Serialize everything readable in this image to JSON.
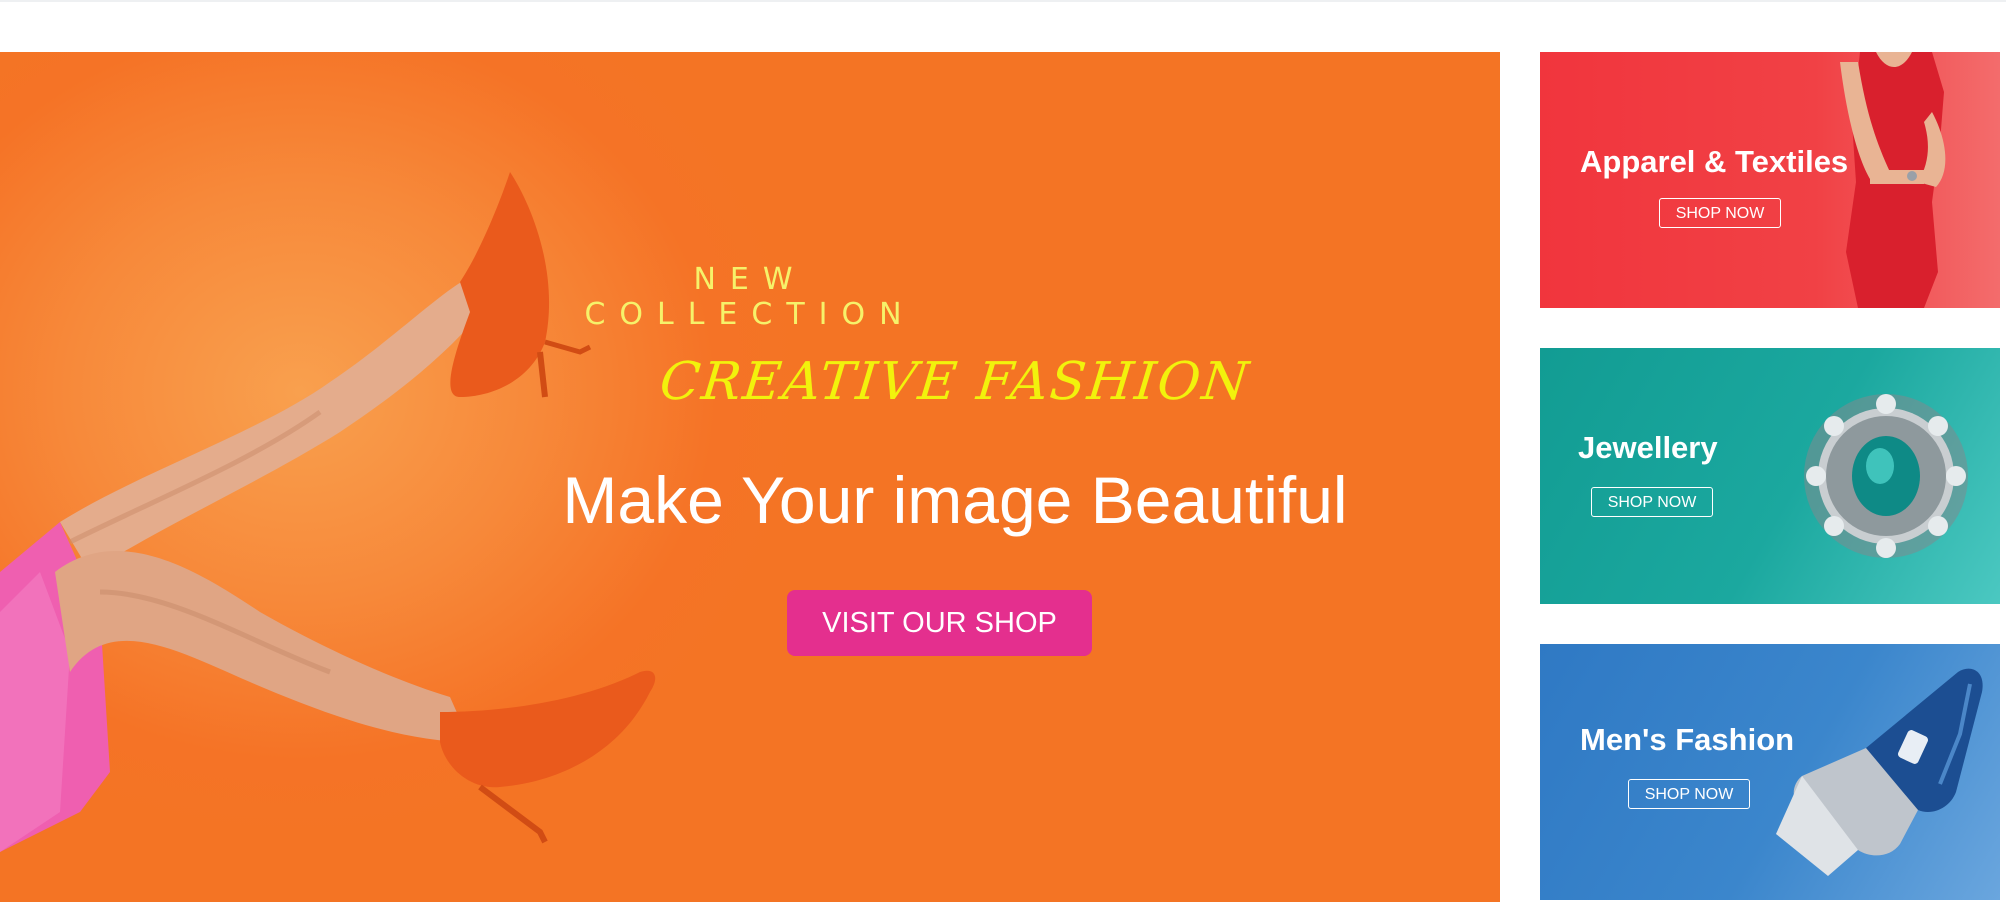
{
  "hero": {
    "tag": "NEW COLLECTION",
    "title": "CREATIVE FASHION",
    "subtitle": "Make Your image Beautiful",
    "cta_label": "VISIT OUR SHOP"
  },
  "banners": [
    {
      "title": "Apparel & Textiles",
      "button": "SHOP NOW"
    },
    {
      "title": "Jewellery",
      "button": "SHOP NOW"
    },
    {
      "title": "Men's Fashion",
      "button": "SHOP NOW"
    }
  ],
  "colors": {
    "hero_bg": "#f57326",
    "tag_text": "#f6f26a",
    "tag_highlight": "#5f0a63",
    "title_text": "#f2f20c",
    "cta_bg": "#e42f8e",
    "banner_red": "#f1353d",
    "banner_teal": "#129c93",
    "banner_blue": "#2f79c4"
  }
}
